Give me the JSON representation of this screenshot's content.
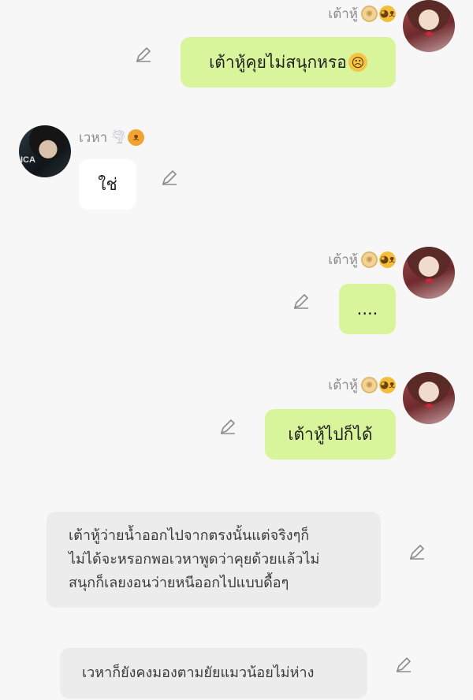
{
  "messages": [
    {
      "sender": "เต้าหู้",
      "emojis": [
        "cookie-emoji",
        "cat-face-emoji"
      ],
      "text": "เต้าหู้คุยไม่สนุกหรอ",
      "trailing_emoji": "slightly-frowning-face-emoji",
      "bubble_color": "#d8f59b"
    },
    {
      "sender": "เวหา",
      "emojis": [
        "tornado-emoji",
        "lion-face-emoji"
      ],
      "text": "ใช่",
      "bubble_color": "#ffffff"
    },
    {
      "sender": "เต้าหู้",
      "emojis": [
        "cookie-emoji",
        "cat-face-emoji"
      ],
      "text": "....",
      "bubble_color": "#d8f59b"
    },
    {
      "sender": "เต้าหู้",
      "emojis": [
        "cookie-emoji",
        "cat-face-emoji"
      ],
      "text": "เต้าหู้ไปก็ได้",
      "bubble_color": "#d8f59b"
    },
    {
      "type": "narration",
      "lines": [
        "เต้าหู้ว่ายน้ำออกไปจากตรงนั้นแต่จริงๆก็",
        "ไม่ได้จะหรอกพอเวหาพูดว่าคุยด้วยแล้วไม่",
        "สนุกก็เลยงอนว่ายหนีออกไปแบบดื้อๆ"
      ],
      "bubble_color": "#ececec"
    },
    {
      "type": "narration",
      "lines": [
        "เวหาก็ยังคงมองตามยัยแมวน้อยไม่ห่าง"
      ],
      "bubble_color": "#ececec"
    }
  ],
  "icons": {
    "edit": "pencil-icon"
  },
  "colors": {
    "background": "#f7f7f7",
    "name_text": "#8a8a8a"
  }
}
